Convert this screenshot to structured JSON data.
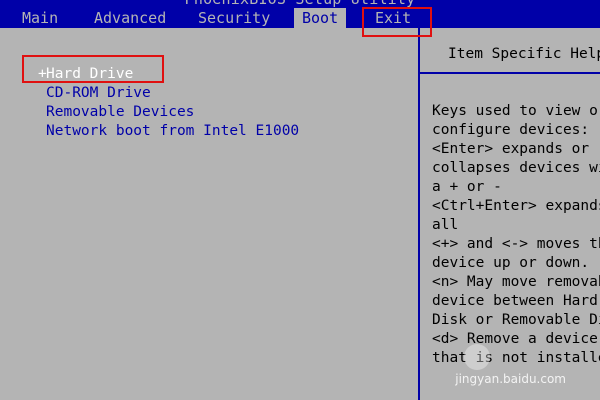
{
  "title": "PhoenixBIOS Setup Utility",
  "menu": [
    {
      "label": "Main",
      "active": false
    },
    {
      "label": "Advanced",
      "active": false
    },
    {
      "label": "Security",
      "active": false
    },
    {
      "label": "Boot",
      "active": true
    },
    {
      "label": "Exit",
      "active": false
    }
  ],
  "boot": {
    "items": [
      {
        "prefix": "+",
        "label": "Hard Drive",
        "selected": true
      },
      {
        "prefix": "",
        "label": "CD-ROM Drive",
        "selected": false
      },
      {
        "prefix": "",
        "label": "Removable Devices",
        "selected": false
      },
      {
        "prefix": "",
        "label": "Network boot from Intel E1000",
        "selected": false
      }
    ]
  },
  "help": {
    "title": "Item Specific Help",
    "lines": [
      "Keys used to view or",
      "configure devices:",
      "<Enter> expands or",
      "collapses devices with",
      "a + or -",
      "<Ctrl+Enter> expands",
      "all",
      "<+> and <-> moves the",
      "device up or down.",
      "<n> May move removable",
      "device between Hard",
      "Disk or Removable Disk",
      "<d> Remove a device",
      "that is not installed"
    ]
  },
  "watermark": "jingyan.baidu.com",
  "colors": {
    "bios_blue": "#0000a8",
    "bios_gray": "#b4b4b4",
    "selected_text": "#ffffff",
    "annotation_red": "#e01010"
  }
}
